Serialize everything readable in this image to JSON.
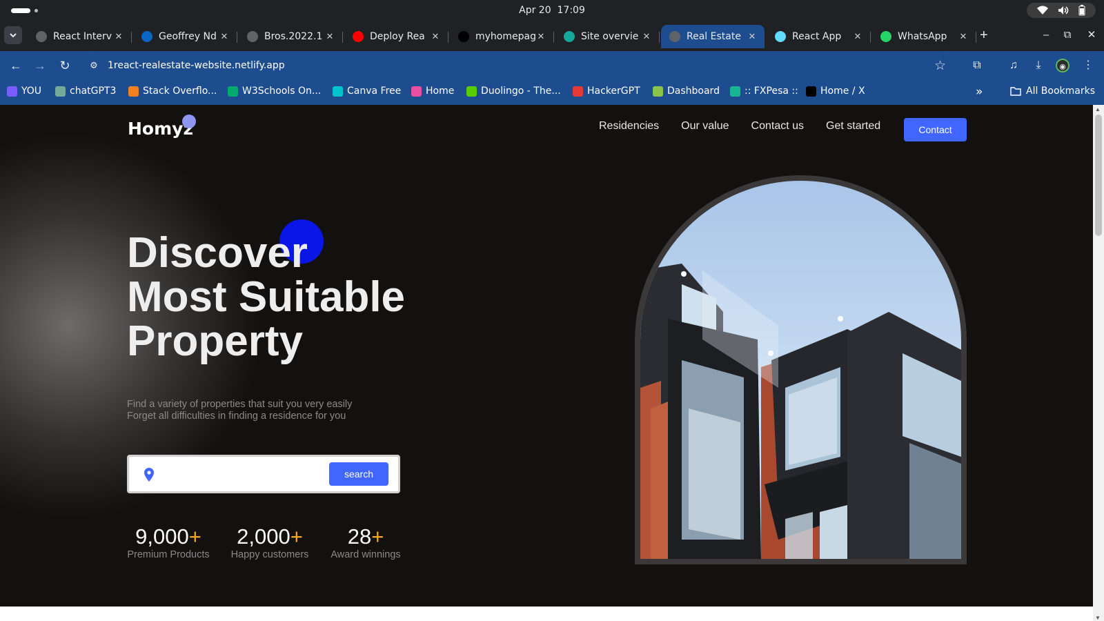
{
  "system_bar": {
    "date": "Apr 20",
    "time": "17:09"
  },
  "tabs": [
    {
      "title": "React Interv",
      "icon": "openai-icon",
      "color": "#5f6368"
    },
    {
      "title": "Geoffrey Nd",
      "icon": "linkedin-icon",
      "color": "#0a66c2"
    },
    {
      "title": "Bros.2022.1",
      "icon": "globe-icon",
      "color": "#5f6368"
    },
    {
      "title": "Deploy Rea",
      "icon": "youtube-icon",
      "color": "#ff0000"
    },
    {
      "title": "myhomepag",
      "icon": "github-icon",
      "color": "#000000"
    },
    {
      "title": "Site overvie",
      "icon": "netlify-icon",
      "color": "#15a89a"
    },
    {
      "title": "Real Estate",
      "icon": "globe-icon",
      "color": "#5f6368",
      "active": true
    },
    {
      "title": "React App",
      "icon": "react-icon",
      "color": "#61dafb"
    },
    {
      "title": "WhatsApp",
      "icon": "whatsapp-icon",
      "color": "#25d366"
    }
  ],
  "address_bar": {
    "url": "1react-realestate-website.netlify.app"
  },
  "bookmarks": [
    {
      "label": "YOU",
      "icon": "you-icon",
      "color": "#7b5cff"
    },
    {
      "label": "chatGPT3",
      "icon": "openai-icon",
      "color": "#74aa9c"
    },
    {
      "label": "Stack Overflo...",
      "icon": "stackoverflow-icon",
      "color": "#f48024"
    },
    {
      "label": "W3Schools On...",
      "icon": "w3schools-icon",
      "color": "#04aa6d"
    },
    {
      "label": "Canva Free",
      "icon": "canva-icon",
      "color": "#00c4cc"
    },
    {
      "label": "Home",
      "icon": "g-icon",
      "color": "#e94fa3"
    },
    {
      "label": "Duolingo - The...",
      "icon": "duolingo-icon",
      "color": "#58cc02"
    },
    {
      "label": "HackerGPT",
      "icon": "hackergpt-icon",
      "color": "#e53935"
    },
    {
      "label": "Dashboard",
      "icon": "cube-icon",
      "color": "#8bc34a"
    },
    {
      "label": ":: FXPesa ::",
      "icon": "fxpesa-icon",
      "color": "#1ab394"
    },
    {
      "label": "Home / X",
      "icon": "x-icon",
      "color": "#000000"
    }
  ],
  "bookmarks_all": "All Bookmarks",
  "site": {
    "logo": "Homyz",
    "nav": [
      "Residencies",
      "Our value",
      "Contact us",
      "Get started"
    ],
    "contact_label": "Contact",
    "hero_title_lines": [
      "Discover",
      "Most Suitable",
      "Property"
    ],
    "hero_sub_lines": [
      "Find a variety of properties that suit you very easily",
      "Forget all difficulties in finding a residence for you"
    ],
    "search_value": "",
    "search_label": "search",
    "stats": [
      {
        "number": "9,000",
        "suffix": "+",
        "label": "Premium Products"
      },
      {
        "number": "2,000",
        "suffix": "+",
        "label": "Happy customers"
      },
      {
        "number": "28",
        "suffix": "+",
        "label": "Award winnings"
      }
    ],
    "accent_color": "#4066ff",
    "stat_accent": "#f5a623"
  }
}
